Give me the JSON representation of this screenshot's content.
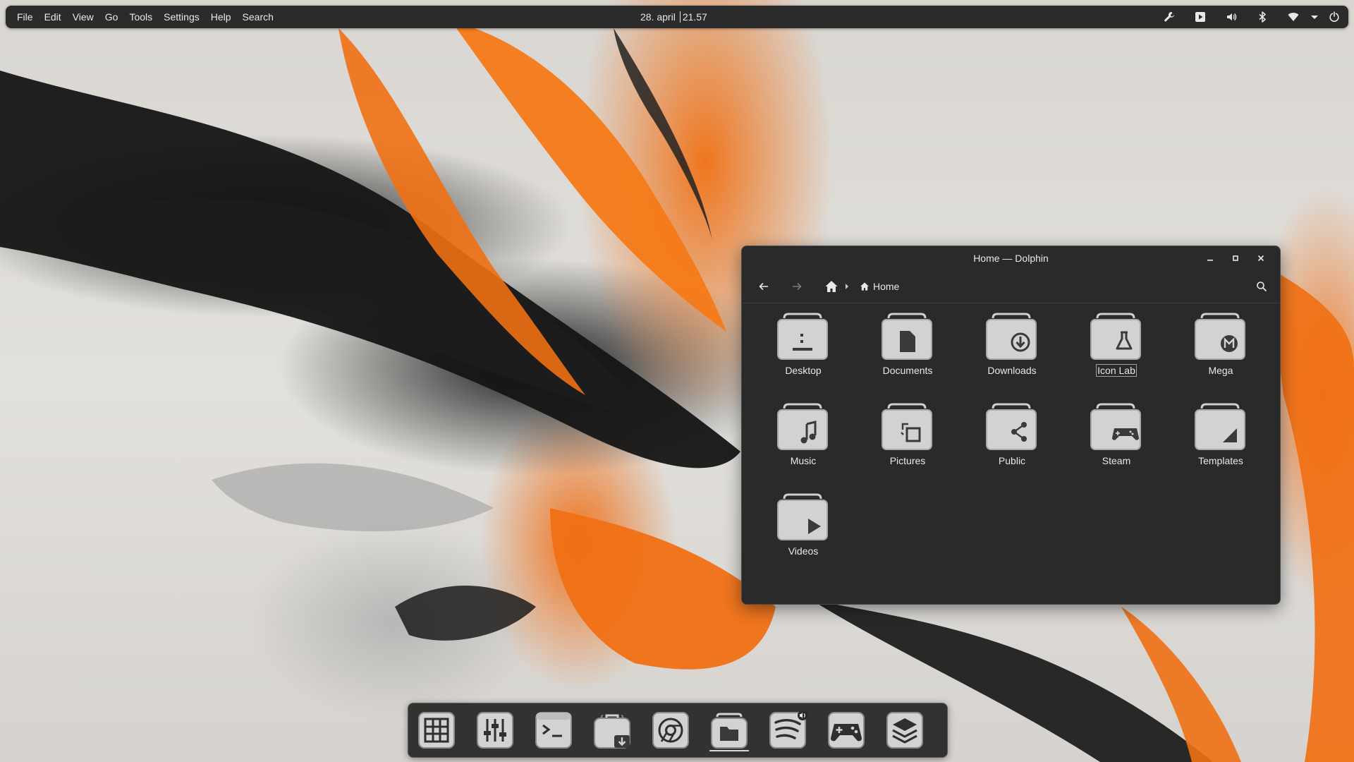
{
  "menubar": {
    "items": [
      "File",
      "Edit",
      "View",
      "Go",
      "Tools",
      "Settings",
      "Help",
      "Search"
    ]
  },
  "clock": {
    "date": "28. april",
    "time": "21.57"
  },
  "tray": {
    "icons": [
      "wrench-icon",
      "media-play-icon",
      "volume-icon",
      "bluetooth-icon",
      "wifi-icon",
      "dropdown-arrow-icon",
      "power-icon"
    ]
  },
  "window": {
    "title": "Home — Dolphin",
    "breadcrumb": {
      "current": "Home"
    },
    "items": [
      {
        "label": "Desktop",
        "icon": "desktop-folder-icon"
      },
      {
        "label": "Documents",
        "icon": "documents-folder-icon"
      },
      {
        "label": "Downloads",
        "icon": "downloads-folder-icon"
      },
      {
        "label": "Icon Lab",
        "icon": "flask-folder-icon",
        "focused": true
      },
      {
        "label": "Mega",
        "icon": "mega-folder-icon"
      },
      {
        "label": "Music",
        "icon": "music-folder-icon"
      },
      {
        "label": "Pictures",
        "icon": "pictures-folder-icon"
      },
      {
        "label": "Public",
        "icon": "share-folder-icon"
      },
      {
        "label": "Steam",
        "icon": "gamepad-folder-icon"
      },
      {
        "label": "Templates",
        "icon": "templates-folder-icon"
      },
      {
        "label": "Videos",
        "icon": "videos-folder-icon"
      }
    ]
  },
  "dock": {
    "apps": [
      "app-grid-icon",
      "mixer-settings-icon",
      "terminal-icon",
      "software-store-icon",
      "chrome-browser-icon",
      "file-manager-icon",
      "spotify-icon",
      "gamepad-icon",
      "stack-layers-icon"
    ],
    "active": "file-manager-icon"
  },
  "colors": {
    "accent": "#f07014",
    "panel": "#2b2b2b",
    "window": "#2a2a2a",
    "text": "#e8e8e8"
  }
}
